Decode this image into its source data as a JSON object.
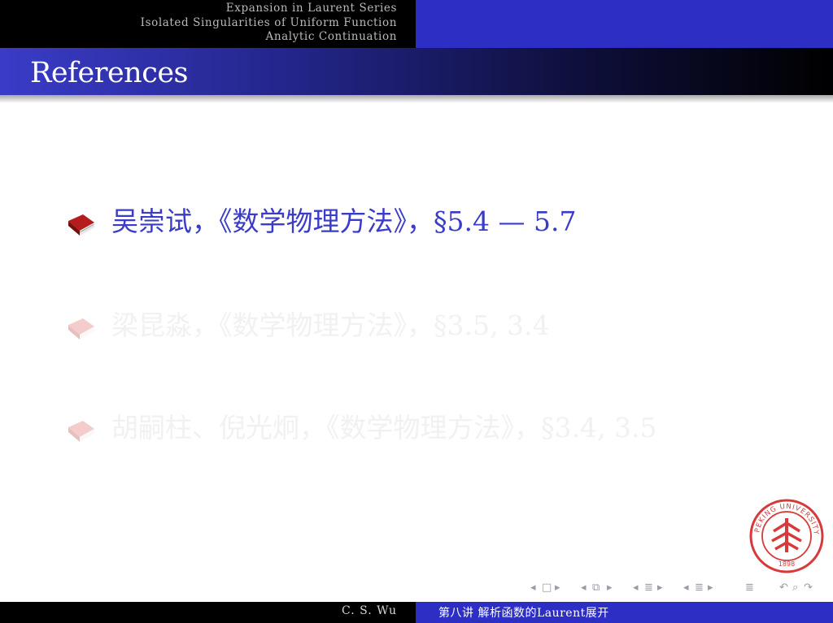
{
  "header": {
    "sections": [
      "Expansion in Laurent Series",
      "Isolated Singularities of Uniform Function",
      "Analytic Continuation"
    ]
  },
  "frame": {
    "title": "References"
  },
  "references": [
    {
      "text": "吴崇试，《数学物理方法》，§5.4 — 5.7",
      "state": "active",
      "icon": "book-icon"
    },
    {
      "text": "梁昆淼，《数学物理方法》，§3.5, 3.4",
      "state": "dimmed",
      "icon": "book-icon"
    },
    {
      "text": "胡嗣柱、倪光炯，《数学物理方法》，§3.4, 3.5",
      "state": "dimmed",
      "icon": "book-icon"
    }
  ],
  "seal": {
    "text": "PEKING UNIVERSITY",
    "year": "1898"
  },
  "footer": {
    "author": "C. S. Wu",
    "course": "第八讲  解析函数的Laurent展开"
  },
  "colors": {
    "accent_blue": "#2d2fc4",
    "title_text": "#ffffff",
    "active_ref": "#3a3cc8",
    "seal_red": "#d63a3a"
  }
}
